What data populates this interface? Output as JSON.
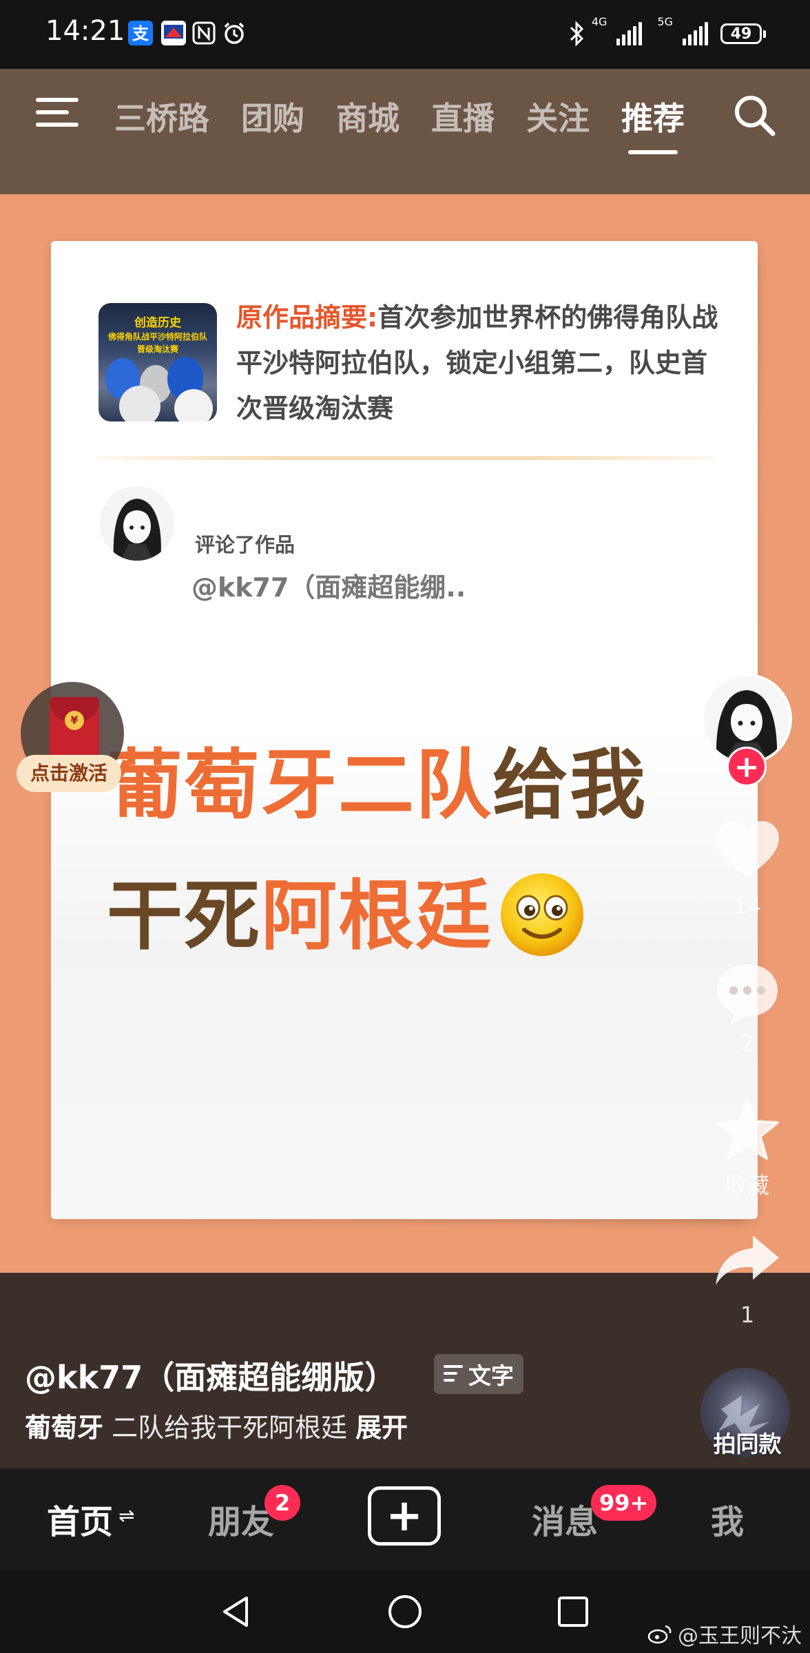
{
  "status_bar": {
    "time": "14:21",
    "network_1": "4G",
    "network_2": "5G",
    "battery": "49"
  },
  "top_nav": {
    "tabs": [
      {
        "label": "三桥路"
      },
      {
        "label": "团购"
      },
      {
        "label": "商城"
      },
      {
        "label": "直播"
      },
      {
        "label": "关注"
      },
      {
        "label": "推荐",
        "active": true
      }
    ]
  },
  "card": {
    "thumb_line1": "创造历史",
    "thumb_line2": "佛得角队战平沙特阿拉伯队",
    "thumb_line3": "晋级淘汰赛",
    "summary_label": "原作品摘要:",
    "summary_text": "首次参加世界杯的佛得角队战平沙特阿拉伯队，锁定小组第二，队史首次晋级淘汰赛",
    "commented_text": "评论了作品",
    "commenter_handle": "@kk77（面瘫超能绷..",
    "big_line1_orange": "葡萄牙二队",
    "big_line1_brown": "给我",
    "big_line2_brown": "干死",
    "big_line2_orange": "阿根廷"
  },
  "envelope": {
    "label": "点击激活",
    "coin": "¥",
    "close": "×"
  },
  "right_rail": {
    "follow": "+",
    "likes": "14",
    "comments": "2",
    "favorite_label": "收藏",
    "shares": "1",
    "same_style_label": "拍同款"
  },
  "caption": {
    "author_handle": "@kk77（面瘫超能绷版）",
    "text_badge": "文字",
    "bold_part": "葡萄牙",
    "rest": " 二队给我干死阿根廷",
    "expand": "展开"
  },
  "bottom_tabs": {
    "home": "首页",
    "home_swap": "⇌",
    "friends": "朋友",
    "friends_badge": "2",
    "create": "+",
    "messages": "消息",
    "messages_badge": "99+",
    "me": "我"
  },
  "watermark": "@玉王则不汏",
  "colors": {
    "accent_red": "#fe2c55",
    "orange_text": "#ee6d35",
    "brown_text": "#6a4825",
    "background": "#ec9b72"
  }
}
